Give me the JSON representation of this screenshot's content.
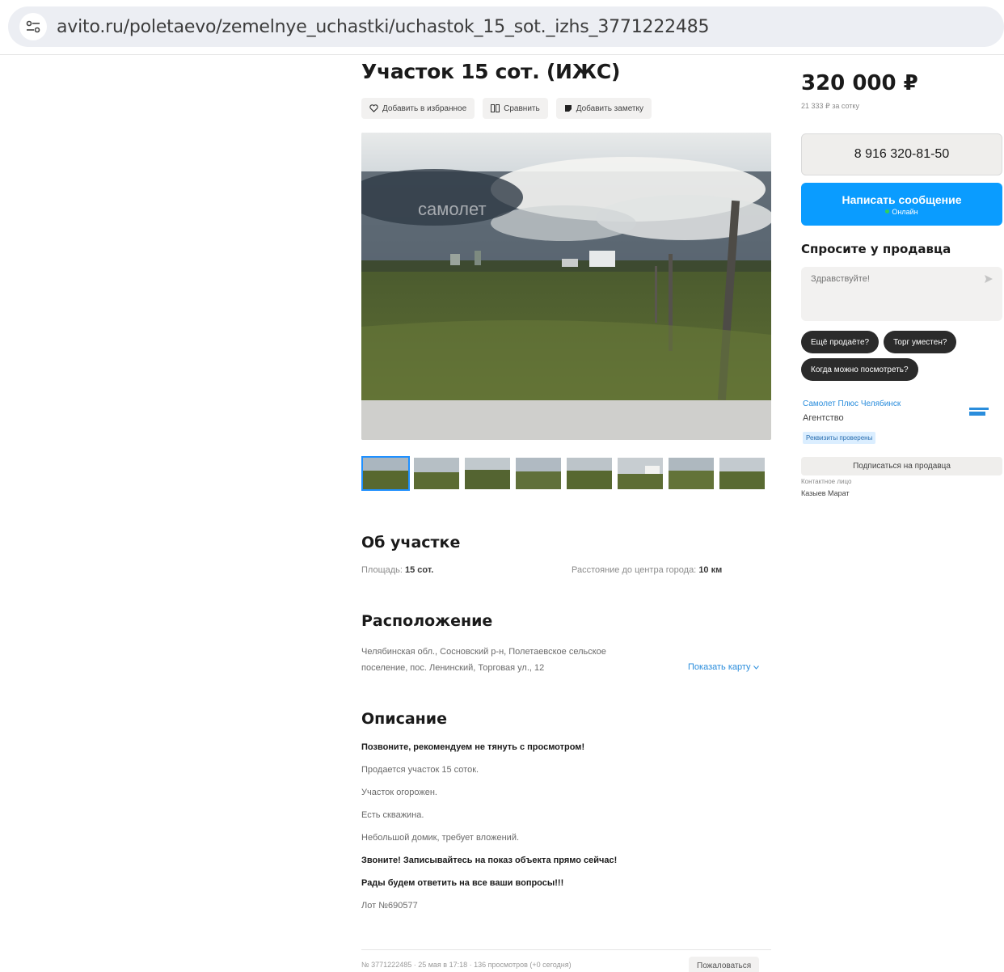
{
  "browser": {
    "url": "avito.ru/poletaevo/zemelnye_uchastki/uchastok_15_sot._izhs_3771222485"
  },
  "listing": {
    "title": "Участок 15 сот. (ИЖС)",
    "actions": {
      "favorite": "Добавить в избранное",
      "compare": "Сравнить",
      "note": "Добавить заметку"
    },
    "photo_watermark": "самолет",
    "thumbnail_count": 8
  },
  "about": {
    "title": "Об участке",
    "area_label": "Площадь:",
    "area_value": "15 сот.",
    "distance_label": "Расстояние до центра города:",
    "distance_value": "10 км"
  },
  "location": {
    "title": "Расположение",
    "address_line1": "Челябинская обл., Сосновский р-н, Полетаевское сельское",
    "address_line2": "поселение, пос. Ленинский, Торговая ул., 12",
    "map_link": "Показать карту"
  },
  "description": {
    "title": "Описание",
    "lines": [
      {
        "text": "Позвоните, рекомендуем не тянуть с просмотром!",
        "bold": true
      },
      {
        "text": "Продается участок 15 соток.",
        "bold": false
      },
      {
        "text": "Участок огорожен.",
        "bold": false
      },
      {
        "text": "Есть скважина.",
        "bold": false
      },
      {
        "text": "Небольшой домик, требует вложений.",
        "bold": false
      },
      {
        "text": "Звоните! Записывайтесь на показ объекта прямо сейчас!",
        "bold": true
      },
      {
        "text": "Рады будем ответить на все ваши вопросы!!!",
        "bold": true
      },
      {
        "text": "Лот №690577",
        "bold": false
      }
    ]
  },
  "footer": {
    "meta": "№ 3771222485 · 25 мая в 17:18 · 136 просмотров (+0 сегодня)",
    "report": "Пожаловаться"
  },
  "sidebar": {
    "price": "320 000 ₽",
    "price_per_unit": "21 333 ₽ за сотку",
    "phone": "8 916 320-81-50",
    "message_button": "Написать сообщение",
    "online_status": "Онлайн",
    "ask_title": "Спросите у продавца",
    "ask_placeholder": "Здравствуйте!",
    "quick_questions": [
      "Ещё продаёте?",
      "Торг уместен?",
      "Когда можно посмотреть?"
    ],
    "seller_name": "Самолет Плюс Челябинск",
    "seller_type": "Агентство",
    "seller_badge": "Реквизиты проверены",
    "subscribe": "Подписаться на продавца",
    "contact_label": "Контактное лицо",
    "contact_name": "Казыев Марат"
  },
  "colors": {
    "accent_blue": "#0a9cff",
    "link_blue": "#2a8ddc",
    "chip_dark": "#2b2b2b"
  }
}
